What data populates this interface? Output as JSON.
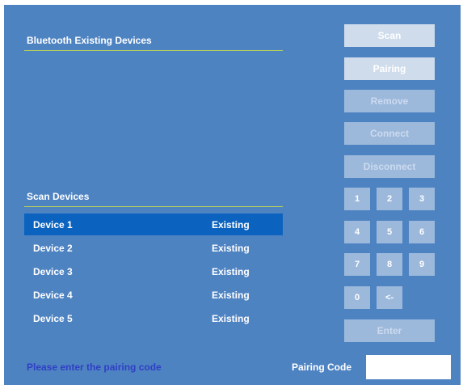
{
  "existing_section": {
    "title": "Bluetooth Existing Devices"
  },
  "scan_section": {
    "title": "Scan Devices"
  },
  "devices": [
    {
      "name": "Device 1",
      "status": "Existing",
      "selected": true
    },
    {
      "name": "Device 2",
      "status": "Existing",
      "selected": false
    },
    {
      "name": "Device 3",
      "status": "Existing",
      "selected": false
    },
    {
      "name": "Device 4",
      "status": "Existing",
      "selected": false
    },
    {
      "name": "Device 5",
      "status": "Existing",
      "selected": false
    }
  ],
  "actions": {
    "scan": "Scan",
    "pairing": "Pairing",
    "remove": "Remove",
    "connect": "Connect",
    "disconnect": "Disconnect",
    "enter": "Enter"
  },
  "keypad": {
    "k1": "1",
    "k2": "2",
    "k3": "3",
    "k4": "4",
    "k5": "5",
    "k6": "6",
    "k7": "7",
    "k8": "8",
    "k9": "9",
    "k0": "0",
    "back": "<-"
  },
  "footer": {
    "message": "Please enter the pairing code",
    "pairing_code_label": "Pairing Code",
    "pairing_code_value": ""
  },
  "colors": {
    "panel_bg": "#4e83c2",
    "selected_row": "#0b63bf",
    "accent_rule": "#b9d05a",
    "message_text": "#2f3fc4"
  }
}
